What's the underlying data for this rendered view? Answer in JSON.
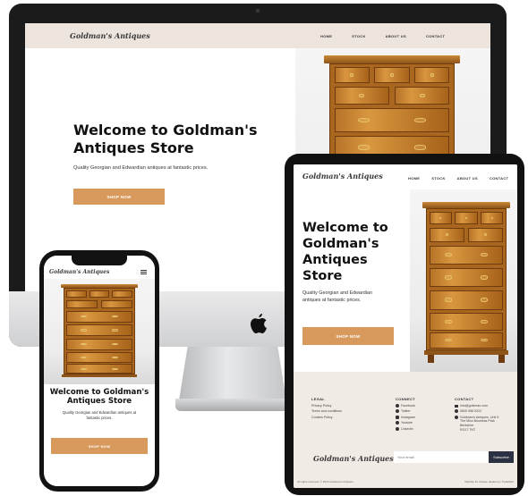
{
  "brand": {
    "logo_text": "Goldman's Antiques"
  },
  "nav": {
    "items": [
      "HOME",
      "STOCK",
      "ABOUT US",
      "CONTACT"
    ]
  },
  "hero": {
    "title_line1": "Welcome to Goldman's",
    "title_line2": "Antiques Store",
    "subtitle": "Quality Georgian and Edwardian antiques at fantastic prices.",
    "cta": "SHOP NOW"
  },
  "tablet": {
    "title_lines": [
      "Welcome to",
      "Goldman's",
      "Antiques",
      "Store"
    ],
    "subtitle_line1": "Quality Georgian and Edwardian",
    "subtitle_line2": "antiques at fantastic prices."
  },
  "phone": {
    "title_line1": "Welcome to Goldman's",
    "title_line2": "Antiques Store",
    "subtitle_line1": "Quality Georgian and Edwardian antiques at",
    "subtitle_line2": "fantastic prices."
  },
  "footer": {
    "legal": {
      "heading": "LEGAL",
      "items": [
        "Privacy Policy",
        "Terms and conditions",
        "Cookies Policy"
      ]
    },
    "connect": {
      "heading": "CONNECT",
      "items": [
        "Facebook",
        "Twitter",
        "Instagram",
        "Youtube",
        "LinkedIn"
      ]
    },
    "contact": {
      "heading": "CONTACT",
      "email": "info@goldman.com",
      "phone": "0800 958 0222",
      "address": [
        "Goldman's Antiques, Unit 5",
        "The Mico Business Park",
        "Berkshire",
        "RG17 7NT"
      ]
    },
    "email_placeholder": "Your email",
    "subscribe": "Subscribe",
    "copyright": "All rights reserved. © 2023 Goldman's Antiques",
    "credit": "Website for antique dealers by TradeMob"
  },
  "colors": {
    "accent": "#d89a5c",
    "nav_bg": "#ede4dd",
    "footer_bg": "#f1ebe6",
    "wood": "#b87328"
  }
}
